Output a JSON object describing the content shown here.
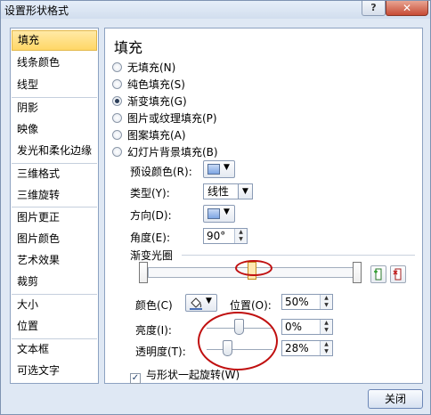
{
  "window": {
    "title": "设置形状格式",
    "help_label": "?",
    "close_label": "✕"
  },
  "sidebar": {
    "items": [
      {
        "label": "填充",
        "selected": true
      },
      {
        "label": "线条颜色"
      },
      {
        "label": "线型"
      },
      {
        "label": "阴影"
      },
      {
        "label": "映像"
      },
      {
        "label": "发光和柔化边缘"
      },
      {
        "label": "三维格式"
      },
      {
        "label": "三维旋转"
      },
      {
        "label": "图片更正"
      },
      {
        "label": "图片颜色"
      },
      {
        "label": "艺术效果"
      },
      {
        "label": "裁剪"
      },
      {
        "label": "大小"
      },
      {
        "label": "位置"
      },
      {
        "label": "文本框"
      },
      {
        "label": "可选文字"
      }
    ]
  },
  "fill": {
    "heading": "填充",
    "options": [
      {
        "label": "无填充(N)",
        "selected": false
      },
      {
        "label": "纯色填充(S)",
        "selected": false
      },
      {
        "label": "渐变填充(G)",
        "selected": true
      },
      {
        "label": "图片或纹理填充(P)",
        "selected": false
      },
      {
        "label": "图案填充(A)",
        "selected": false
      },
      {
        "label": "幻灯片背景填充(B)",
        "selected": false
      }
    ],
    "preset_label": "预设颜色(R):",
    "type_label": "类型(Y):",
    "type_value": "线性",
    "direction_label": "方向(D):",
    "angle_label": "角度(E):",
    "angle_value": "90°",
    "stops_label": "渐变光圈",
    "color_label": "颜色(C)",
    "position_label": "位置(O):",
    "position_value": "50%",
    "brightness_label": "亮度(I):",
    "brightness_value": "0%",
    "transparency_label": "透明度(T):",
    "transparency_value": "28%",
    "rotate_label": "与形状一起旋转(W)",
    "rotate_checked": true
  },
  "footer": {
    "close_label": "关闭"
  },
  "colors": {
    "accent": "#c01010",
    "selection": "#ffd766"
  },
  "icons": {
    "dropdown": "▼",
    "spin_up": "▲",
    "spin_down": "▼",
    "check": "✓",
    "paint": "bucket-icon"
  }
}
